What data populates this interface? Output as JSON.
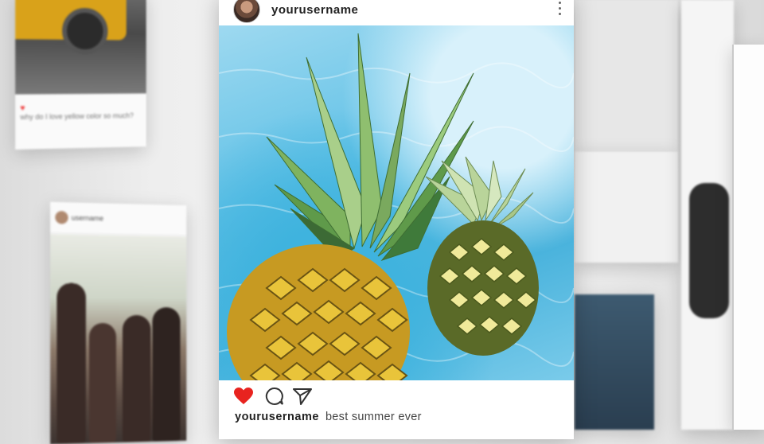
{
  "background_posts": {
    "top_left": {
      "caption": "why do I love yellow color so much?"
    },
    "bottom_left": {
      "username": "username"
    }
  },
  "post": {
    "username": "yourusername",
    "caption": {
      "username": "yourusername",
      "text": "best summer ever"
    },
    "icons": {
      "like": "heart-icon",
      "comment": "comment-icon",
      "share": "share-icon",
      "more": "more-icon"
    },
    "colors": {
      "like": "#e8231f"
    }
  }
}
